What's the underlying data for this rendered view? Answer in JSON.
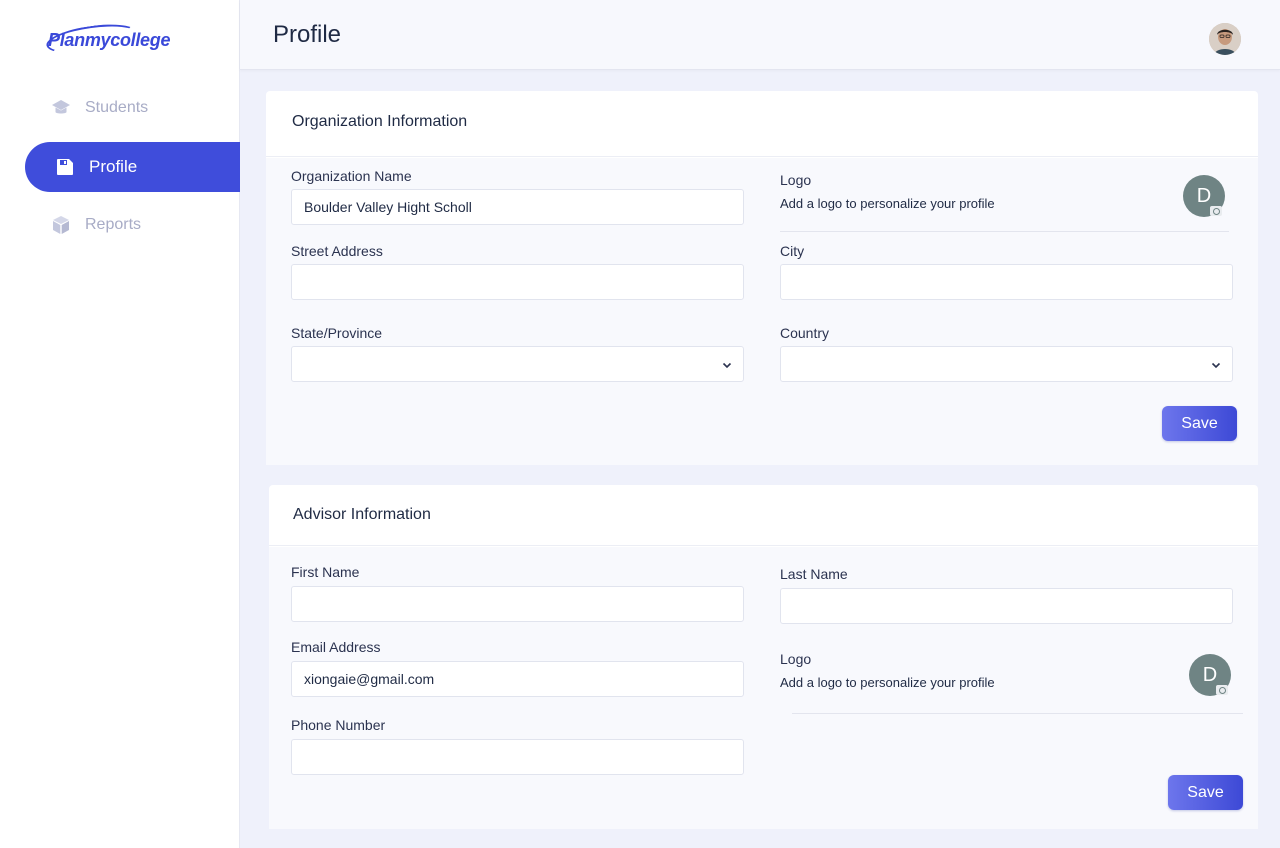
{
  "brand": {
    "name": "Planmycollege",
    "color": "#3a49d9"
  },
  "sidebar": {
    "items": [
      {
        "label": "Students",
        "icon": "graduation-cap-icon",
        "active": false
      },
      {
        "label": "Profile",
        "icon": "save-icon",
        "active": true
      },
      {
        "label": "Reports",
        "icon": "box-icon",
        "active": false
      }
    ]
  },
  "header": {
    "title": "Profile",
    "avatar": "user-avatar"
  },
  "organization": {
    "title": "Organization Information",
    "name_label": "Organization Name",
    "name_value": "Boulder Valley Hight Scholl",
    "logo_label": "Logo",
    "logo_hint": "Add a logo to personalize your profile",
    "logo_initial": "D",
    "street_label": "Street Address",
    "street_value": "",
    "city_label": "City",
    "city_value": "",
    "state_label": "State/Province",
    "state_value": "",
    "country_label": "Country",
    "country_value": "",
    "save_label": "Save"
  },
  "advisor": {
    "title": "Advisor Information",
    "first_name_label": "First Name",
    "first_name_value": "",
    "last_name_label": "Last Name",
    "last_name_value": "",
    "email_label": "Email Address",
    "email_value": "xiongaie@gmail.com",
    "logo_label": "Logo",
    "logo_hint": "Add a logo to personalize your profile",
    "logo_initial": "D",
    "phone_label": "Phone Number",
    "phone_value": "",
    "save_label": "Save"
  },
  "colors": {
    "accent": "#3f4ddb",
    "background": "#eff1fb",
    "muted_nav": "#a8acc6"
  }
}
